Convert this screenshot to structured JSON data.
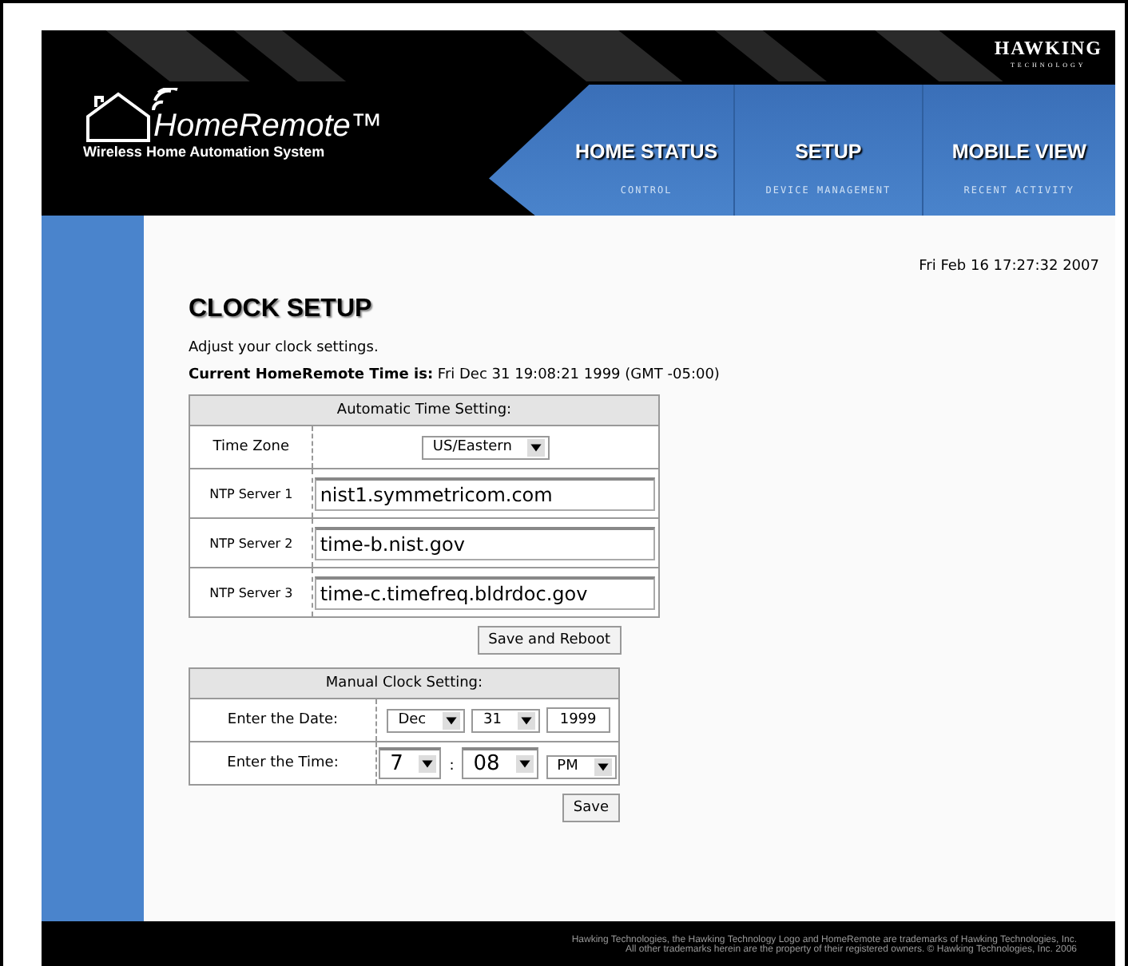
{
  "brand": {
    "name": "HomeRemote™",
    "tagline": "Wireless Home Automation System",
    "vendor": "HAWKING",
    "vendor_sub": "TECHNOLOGY"
  },
  "nav": {
    "tabs": [
      {
        "label": "HOME STATUS",
        "sub": "CONTROL"
      },
      {
        "label": "SETUP",
        "sub": "DEVICE MANAGEMENT"
      },
      {
        "label": "MOBILE VIEW",
        "sub": "RECENT ACTIVITY"
      }
    ]
  },
  "page": {
    "date": "Fri Feb 16 17:27:32 2007",
    "title": "CLOCK SETUP",
    "intro": "Adjust your clock settings.",
    "current_time": "**Current HomeRemote Time is:** Fri Dec 31 19:08:21 1999 (GMT -05:00)"
  },
  "automatic": {
    "heading": "Automatic Time Setting:",
    "timezone_label": "Time Zone",
    "timezone": "US/Eastern",
    "servers": [
      {
        "label": "NTP Server 1",
        "value": "nist1.symmetricom.com"
      },
      {
        "label": "NTP Server 2",
        "value": "time-b.nist.gov"
      },
      {
        "label": "NTP Server 3",
        "value": "time-c.timefreq.bldrdoc.gov"
      }
    ],
    "button": "Save and Reboot"
  },
  "manual": {
    "heading": "Manual Clock Setting:",
    "date_label": "Enter the Date:",
    "month": "Dec",
    "day": "31",
    "year": "1999",
    "time_label": "Enter the Time:",
    "hour": "7",
    "separator": ":",
    "minute": "08",
    "ampm": "PM",
    "button": "Save"
  },
  "footer": [
    "Hawking Technologies, the Hawking Technology Logo and HomeRemote are trademarks of Hawking Technologies, Inc.",
    "All other trademarks herein are the property of their registered owners. © Hawking Technologies, Inc. 2006"
  ]
}
